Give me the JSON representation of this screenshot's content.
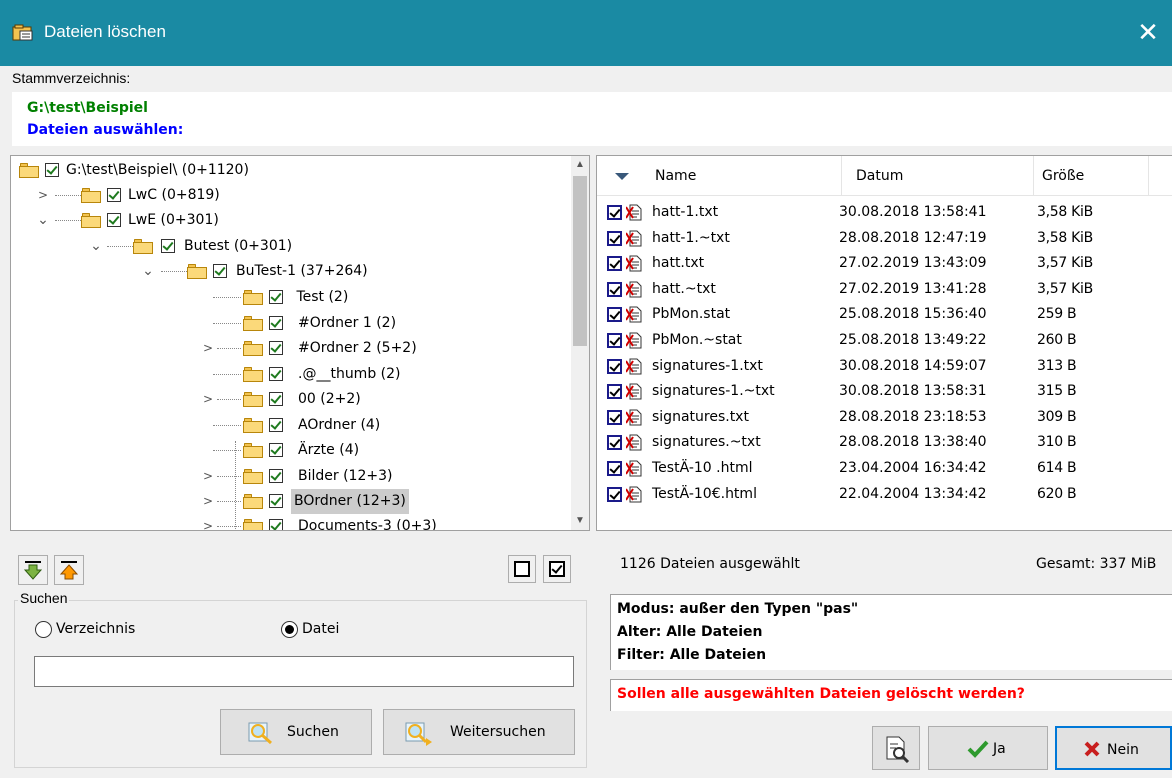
{
  "window": {
    "title": "Dateien löschen",
    "close_glyph": "✕",
    "accent": "#1a8aa3"
  },
  "root": {
    "label": "Stammverzeichnis:",
    "path": "G:\\test\\Beispiel",
    "prompt": "Dateien auswählen:"
  },
  "tree": {
    "items": [
      {
        "label": "G:\\test\\Beispiel\\ (0+1120)"
      },
      {
        "label": "LwC (0+819)"
      },
      {
        "label": "LwE (0+301)"
      },
      {
        "label": "Butest (0+301)"
      },
      {
        "label": "BuTest-1 (37+264)"
      },
      {
        "label": " Test (2)"
      },
      {
        "label": "#Ordner 1 (2)"
      },
      {
        "label": "#Ordner 2 (5+2)"
      },
      {
        "label": ".@__thumb (2)"
      },
      {
        "label": "00 (2+2)"
      },
      {
        "label": "AOrdner (4)"
      },
      {
        "label": "Ärzte (4)"
      },
      {
        "label": "Bilder (12+3)"
      },
      {
        "label": "BOrdner (12+3)"
      },
      {
        "label": "Documents-3 (0+3)"
      }
    ]
  },
  "files": {
    "columns": {
      "name": "Name",
      "date": "Datum",
      "size": "Größe"
    },
    "rows": [
      {
        "name": "hatt-1.txt",
        "date": "30.08.2018 13:58:41",
        "size": "3,58 KiB"
      },
      {
        "name": "hatt-1.~txt",
        "date": "28.08.2018 12:47:19",
        "size": "3,58 KiB"
      },
      {
        "name": "hatt.txt",
        "date": "27.02.2019 13:43:09",
        "size": "3,57 KiB"
      },
      {
        "name": "hatt.~txt",
        "date": "27.02.2019 13:41:28",
        "size": "3,57 KiB"
      },
      {
        "name": "PbMon.stat",
        "date": "25.08.2018 15:36:40",
        "size": "259 B"
      },
      {
        "name": "PbMon.~stat",
        "date": "25.08.2018 13:49:22",
        "size": "260 B"
      },
      {
        "name": "signatures-1.txt",
        "date": "30.08.2018 14:59:07",
        "size": "313 B"
      },
      {
        "name": "signatures-1.~txt",
        "date": "30.08.2018 13:58:31",
        "size": "315 B"
      },
      {
        "name": "signatures.txt",
        "date": "28.08.2018 23:18:53",
        "size": "309 B"
      },
      {
        "name": "signatures.~txt",
        "date": "28.08.2018 13:38:40",
        "size": "310 B"
      },
      {
        "name": "TestÄ-10 .html",
        "date": "23.04.2004 16:34:42",
        "size": "614 B"
      },
      {
        "name": "TestÄ-10€.html",
        "date": "22.04.2004 13:34:42",
        "size": "620 B"
      }
    ]
  },
  "status": {
    "selected": "1126 Dateien ausgewählt",
    "total": "Gesamt: 337 MiB"
  },
  "search": {
    "legend": "Suchen",
    "radio_dir": "Verzeichnis",
    "radio_file": "Datei",
    "selected": "Datei",
    "value": "",
    "search_btn": "Suchen",
    "next_btn": "Weitersuchen"
  },
  "mode": {
    "line1": "Modus: außer den Typen \"pas\"",
    "line2": "Alter: Alle Dateien",
    "line3": "Filter: Alle Dateien"
  },
  "question": "Sollen alle ausgewählten Dateien gelöscht werden?",
  "buttons": {
    "yes": "Ja",
    "no": "Nein"
  }
}
